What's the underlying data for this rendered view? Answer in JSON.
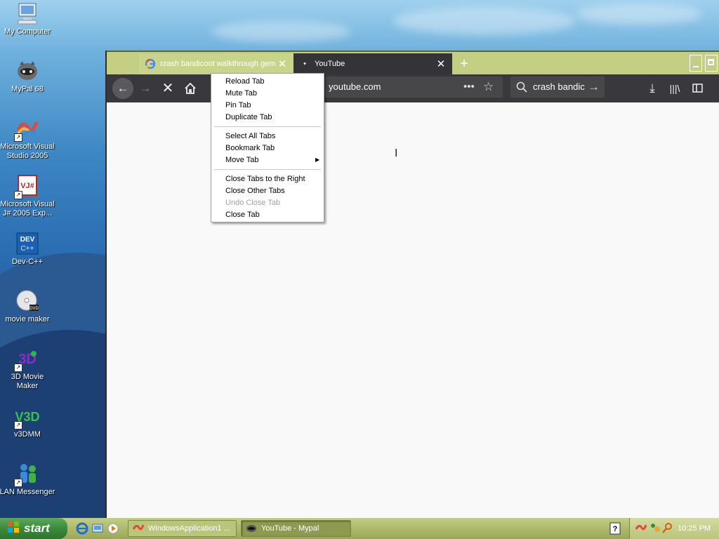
{
  "desktop": {
    "icons": [
      {
        "label": "My Computer",
        "icon": "computer-icon"
      },
      {
        "label": "MyPal 68",
        "icon": "mypal-icon"
      },
      {
        "label": "Microsoft Visual Studio 2005",
        "icon": "visual-studio-icon"
      },
      {
        "label": "Microsoft Visual J# 2005 Exp...",
        "icon": "vjsharp-icon"
      },
      {
        "label": "Dev-C++",
        "icon": "devcpp-icon"
      },
      {
        "label": "movie maker",
        "icon": "dvd-icon"
      },
      {
        "label": "3D Movie Maker",
        "icon": "3d-movie-maker-icon"
      },
      {
        "label": "v3DMM",
        "icon": "v3dmm-icon"
      },
      {
        "label": "LAN Messenger",
        "icon": "lan-messenger-icon"
      }
    ]
  },
  "browser": {
    "tabs": [
      {
        "title": "crash bandicoot walkthrough gem",
        "favicon": "google-icon",
        "active": false
      },
      {
        "title": "YouTube",
        "favicon": "loading-dot",
        "active": true
      }
    ],
    "url": "youtube.com",
    "search_text": "crash bandic"
  },
  "context_menu": {
    "groups": [
      [
        {
          "label": "Reload Tab",
          "enabled": true
        },
        {
          "label": "Mute Tab",
          "enabled": true
        },
        {
          "label": "Pin Tab",
          "enabled": true
        },
        {
          "label": "Duplicate Tab",
          "enabled": true
        }
      ],
      [
        {
          "label": "Select All Tabs",
          "enabled": true
        },
        {
          "label": "Bookmark Tab",
          "enabled": true
        },
        {
          "label": "Move Tab",
          "enabled": true,
          "submenu": true
        }
      ],
      [
        {
          "label": "Close Tabs to the Right",
          "enabled": true
        },
        {
          "label": "Close Other Tabs",
          "enabled": true
        },
        {
          "label": "Undo Close Tab",
          "enabled": false
        },
        {
          "label": "Close Tab",
          "enabled": true
        }
      ]
    ]
  },
  "taskbar": {
    "start_label": "start",
    "items": [
      {
        "label": "WindowsApplication1 ...",
        "icon": "visual-studio-icon",
        "active": false
      },
      {
        "label": "YouTube - Mypal",
        "icon": "mypal-icon",
        "active": true
      }
    ],
    "clock": "10:25 PM"
  },
  "colors": {
    "titlebar": "#c5cf83",
    "navbar": "#39393d",
    "active_tab": "#343438",
    "taskbar": "#aeba6a",
    "start_button": "#3b8a3a"
  }
}
